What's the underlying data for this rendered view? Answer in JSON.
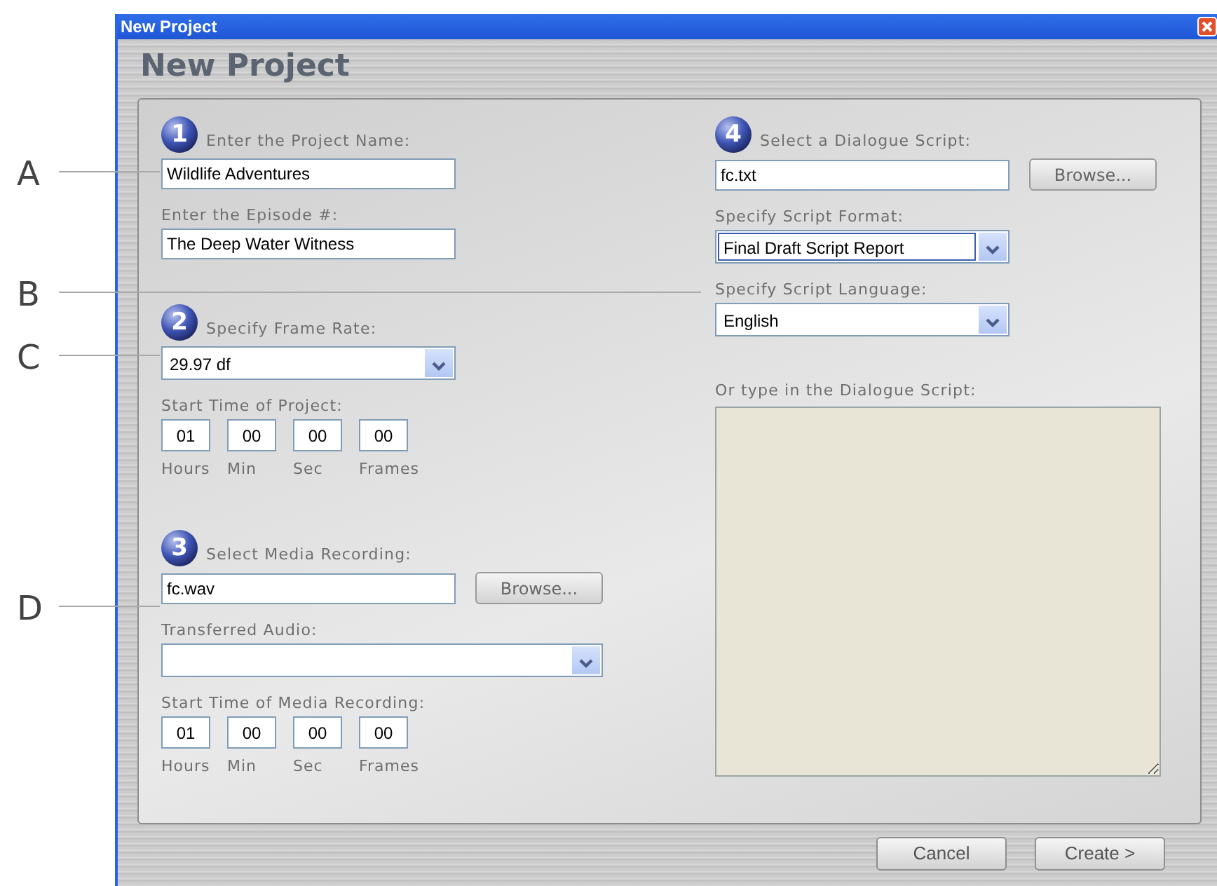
{
  "window": {
    "title": "New Project"
  },
  "heading": "New Project",
  "callouts": [
    {
      "letter": "A"
    },
    {
      "letter": "B"
    },
    {
      "letter": "C"
    },
    {
      "letter": "D"
    }
  ],
  "columns": [
    {
      "sections": [
        {
          "step": "1",
          "title": "Enter the Project Name:",
          "fields": [
            {
              "kind": "text",
              "value": "Wildlife Adventures"
            },
            {
              "kind": "text",
              "label": "Enter the Episode #:",
              "value": "The Deep Water Witness"
            }
          ]
        },
        {
          "step": "2",
          "title": "Specify Frame Rate:",
          "fields": [
            {
              "kind": "select",
              "value": "29.97 df",
              "focused": false,
              "wide": false
            },
            {
              "kind": "time",
              "label": "Start Time of Project:",
              "parts": [
                {
                  "value": "01",
                  "caption": "Hours"
                },
                {
                  "value": "00",
                  "caption": "Min"
                },
                {
                  "value": "00",
                  "caption": "Sec"
                },
                {
                  "value": "00",
                  "caption": "Frames"
                }
              ]
            }
          ]
        },
        {
          "step": "3",
          "title": "Select Media Recording:",
          "fields": [
            {
              "kind": "text",
              "value": "fc.wav",
              "button": "Browse..."
            },
            {
              "kind": "select",
              "label": "Transferred Audio:",
              "focused": false,
              "wide": true
            },
            {
              "kind": "time",
              "label": "Start Time of Media Recording:",
              "parts": [
                {
                  "value": "01",
                  "caption": "Hours"
                },
                {
                  "value": "00",
                  "caption": "Min"
                },
                {
                  "value": "00",
                  "caption": "Sec"
                },
                {
                  "value": "00",
                  "caption": "Frames"
                }
              ]
            }
          ]
        }
      ]
    },
    {
      "sections": [
        {
          "step": "4",
          "title": "Select a Dialogue Script:",
          "fields": [
            {
              "kind": "text",
              "value": "fc.txt",
              "button": "Browse..."
            },
            {
              "kind": "select",
              "label": "Specify Script Format:",
              "value": "Final Draft Script Report",
              "focused": true,
              "wide": false
            },
            {
              "kind": "select",
              "label": "Specify Script Language:",
              "value": "English",
              "focused": false,
              "wide": false
            },
            {
              "kind": "textarea",
              "label": "Or type in the Dialogue Script:"
            }
          ]
        }
      ]
    }
  ],
  "buttons": [
    {
      "label": "Cancel"
    },
    {
      "label": "Create >"
    }
  ]
}
